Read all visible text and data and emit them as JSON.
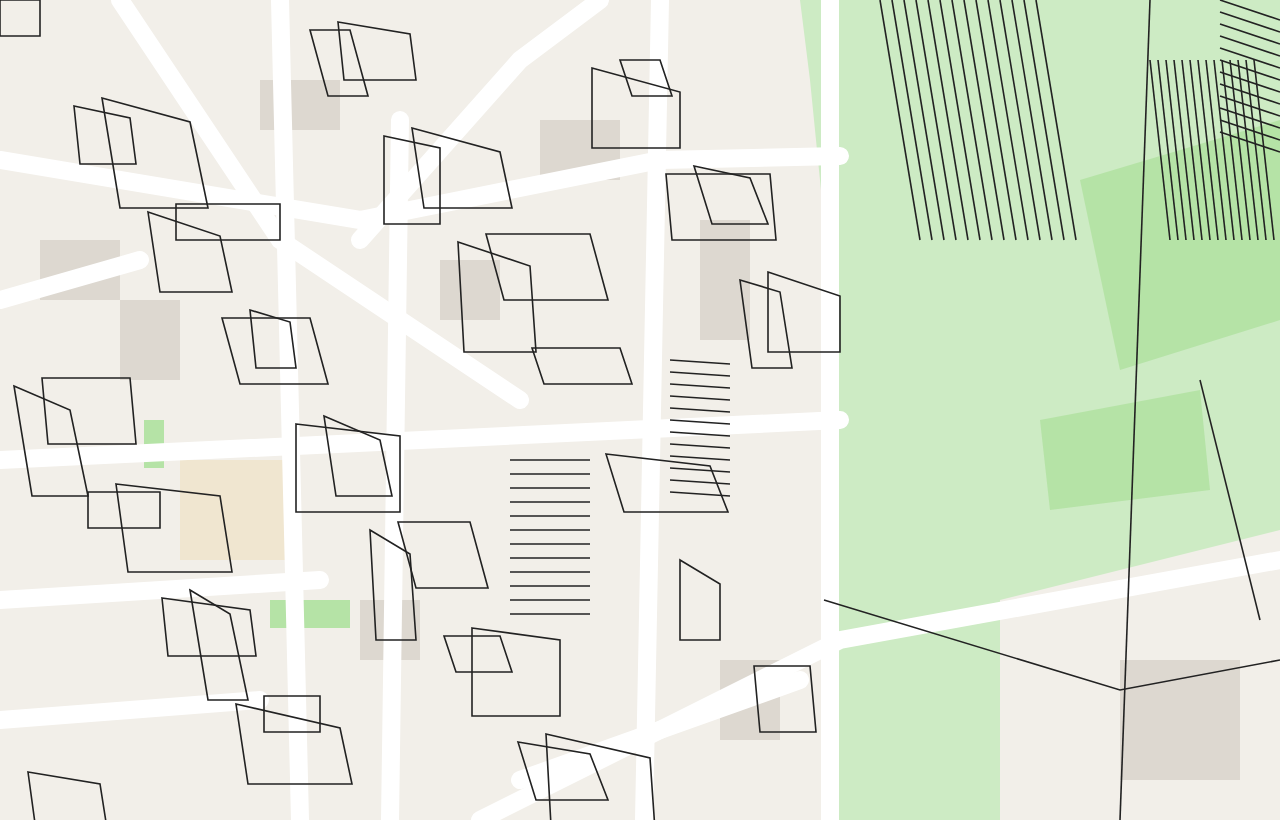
{
  "map": {
    "kind": "street-map"
  }
}
